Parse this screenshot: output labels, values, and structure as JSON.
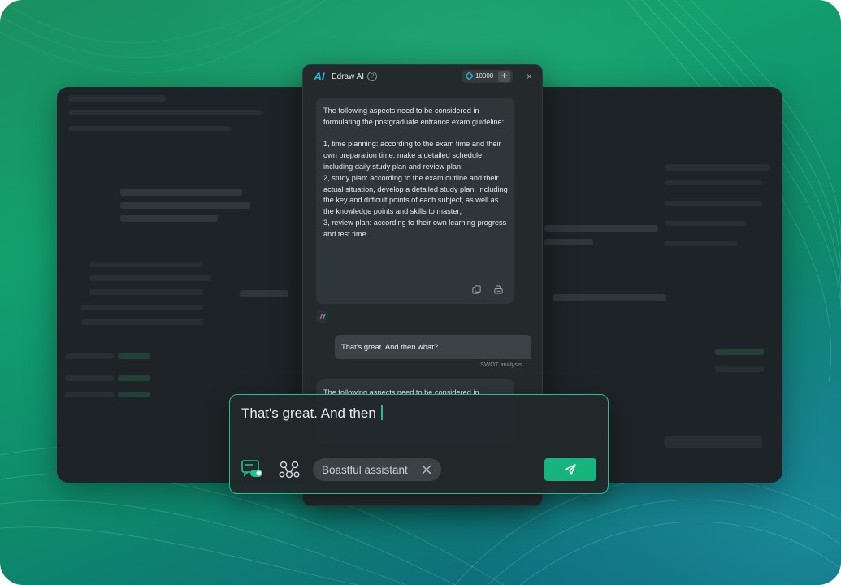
{
  "colors": {
    "accent": "#22c08a",
    "send_button": "#17b47d",
    "panel_bg": "#24292c",
    "bubble_bg": "#2f3639",
    "user_bubble_bg": "#3a4246",
    "logo": "#2fb5e0"
  },
  "panel": {
    "logo": "AI",
    "title": "Edraw AI",
    "help_icon": "?",
    "credits": "10000",
    "credits_add": "+",
    "close_icon": "×"
  },
  "messages": {
    "ai_reply": "The following aspects need to be considered in formulating the postgraduate entrance exam guideline:\n\n1, time planning: according to the exam time and their own preparation time, make a detailed schedule, including daily study plan and review plan;\n2, study plan: according to the exam outline and their actual situation, develop a detailed study plan, including the key and difficult points of each subject, as well as the knowledge points and skills to master;\n3, review plan: according to their own learning progress and test time.",
    "user_message": "That's great. And then what?",
    "user_tag": "SWOT analysis",
    "ai_reply_2": "The following aspects need to be considered in"
  },
  "input": {
    "value": "That's great. And then",
    "role_chip": "Boastful assistant"
  },
  "icons": {
    "copy": "copy-icon",
    "insert": "insert-icon",
    "avatar": "edraw-avatar-icon",
    "tool1": "chat-toggle-icon",
    "tool2": "mindmap-nodes-icon",
    "chip_close": "close-icon",
    "send": "send-icon"
  }
}
